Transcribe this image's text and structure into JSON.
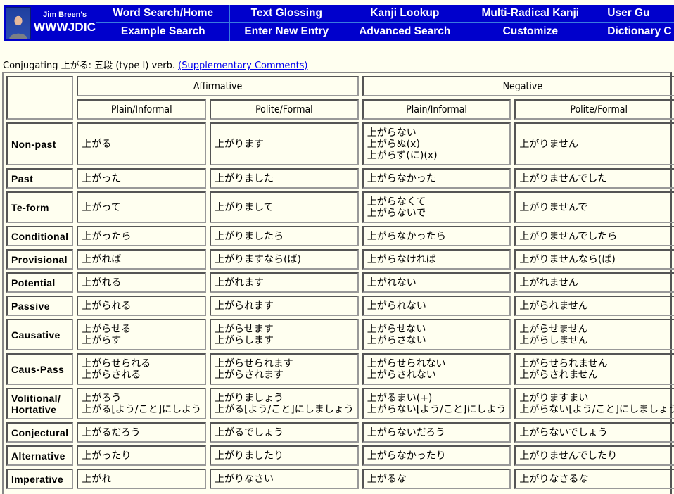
{
  "header": {
    "brand_sub": "Jim Breen's",
    "brand_main": "WWWJDIC",
    "nav_top": [
      "Word Search/Home",
      "Text Glossing",
      "Kanji Lookup",
      "Multi-Radical Kanji",
      "User Gu"
    ],
    "nav_bottom": [
      "Example Search",
      "Enter New Entry",
      "Advanced Search",
      "Customize",
      "Dictionary C"
    ]
  },
  "caption": {
    "text": "Conjugating 上がる: 五段 (type I) verb. ",
    "link": "(Supplementary Comments)"
  },
  "table": {
    "groups": [
      "Affirmative",
      "Negative"
    ],
    "subheaders": [
      "Plain/Informal",
      "Polite/Formal",
      "Plain/Informal",
      "Polite/Formal"
    ],
    "rows": [
      {
        "label": "Non-past",
        "cells": [
          [
            "上がる"
          ],
          [
            "上がります"
          ],
          [
            "上がらない",
            "上がらぬ(x)",
            "上がらず(に)(x)"
          ],
          [
            "上がりません"
          ]
        ]
      },
      {
        "label": "Past",
        "cells": [
          [
            "上がった"
          ],
          [
            "上がりました"
          ],
          [
            "上がらなかった"
          ],
          [
            "上がりませんでした"
          ]
        ]
      },
      {
        "label": "Te-form",
        "cells": [
          [
            "上がって"
          ],
          [
            "上がりまして"
          ],
          [
            "上がらなくて",
            "上がらないで"
          ],
          [
            "上がりませんで"
          ]
        ]
      },
      {
        "label": "Conditional",
        "cells": [
          [
            "上がったら"
          ],
          [
            "上がりましたら"
          ],
          [
            "上がらなかったら"
          ],
          [
            "上がりませんでしたら"
          ]
        ]
      },
      {
        "label": "Provisional",
        "cells": [
          [
            "上がれば"
          ],
          [
            "上がりますなら(ば)"
          ],
          [
            "上がらなければ"
          ],
          [
            "上がりませんなら(ば)"
          ]
        ]
      },
      {
        "label": "Potential",
        "cells": [
          [
            "上がれる"
          ],
          [
            "上がれます"
          ],
          [
            "上がれない"
          ],
          [
            "上がれません"
          ]
        ]
      },
      {
        "label": "Passive",
        "cells": [
          [
            "上がられる"
          ],
          [
            "上がられます"
          ],
          [
            "上がられない"
          ],
          [
            "上がられません"
          ]
        ]
      },
      {
        "label": "Causative",
        "cells": [
          [
            "上がらせる",
            "上がらす"
          ],
          [
            "上がらせます",
            "上がらします"
          ],
          [
            "上がらせない",
            "上がらさない"
          ],
          [
            "上がらせません",
            "上がらしません"
          ]
        ]
      },
      {
        "label": "Caus-Pass",
        "cells": [
          [
            "上がらせられる",
            "上がらされる"
          ],
          [
            "上がらせられます",
            "上がらされます"
          ],
          [
            "上がらせられない",
            "上がらされない"
          ],
          [
            "上がらせられません",
            "上がらされません"
          ]
        ]
      },
      {
        "label": "Volitional/ Hortative",
        "labelLines": [
          "Volitional/",
          "Hortative"
        ],
        "cells": [
          [
            "上がろう",
            "上がる[よう/こと]にしよう"
          ],
          [
            "上がりましょう",
            "上がる[よう/こと]にしましょう"
          ],
          [
            "上がるまい(+)",
            "上がらない[よう/こと]にしよう"
          ],
          [
            "上がりますまい",
            "上がらない[よう/こと]にしましょう"
          ]
        ]
      },
      {
        "label": "Conjectural",
        "cells": [
          [
            "上がるだろう"
          ],
          [
            "上がるでしょう"
          ],
          [
            "上がらないだろう"
          ],
          [
            "上がらないでしょう"
          ]
        ]
      },
      {
        "label": "Alternative",
        "cells": [
          [
            "上がったり"
          ],
          [
            "上がりましたり"
          ],
          [
            "上がらなかったり"
          ],
          [
            "上がりませんでしたり"
          ]
        ]
      },
      {
        "label": "Imperative",
        "cells": [
          [
            "上がれ"
          ],
          [
            "上がりなさい"
          ],
          [
            "上がるな"
          ],
          [
            "上がりなさるな"
          ]
        ]
      }
    ]
  }
}
